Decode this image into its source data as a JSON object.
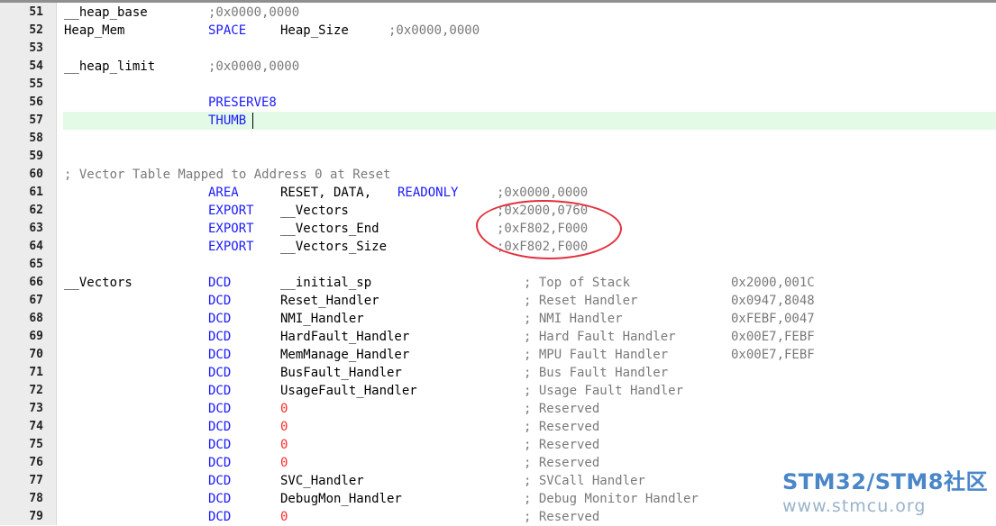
{
  "editor": {
    "lines": [
      {
        "n": "51",
        "tokens": [
          {
            "t": "__heap_base",
            "c": "",
            "col": 0
          },
          {
            "t": ";0x0000,0000",
            "c": "cm",
            "col": 16
          }
        ]
      },
      {
        "n": "52",
        "tokens": [
          {
            "t": "Heap_Mem",
            "c": "",
            "col": 0
          },
          {
            "t": "SPACE",
            "c": "kw",
            "col": 16
          },
          {
            "t": "Heap_Size",
            "c": "",
            "col": 24
          },
          {
            "t": ";0x0000,0000",
            "c": "cm",
            "col": 36
          }
        ]
      },
      {
        "n": "53",
        "tokens": []
      },
      {
        "n": "54",
        "tokens": [
          {
            "t": "__heap_limit",
            "c": "",
            "col": 0
          },
          {
            "t": ";0x0000,0000",
            "c": "cm",
            "col": 16
          }
        ]
      },
      {
        "n": "55",
        "tokens": []
      },
      {
        "n": "56",
        "tokens": [
          {
            "t": "PRESERVE8",
            "c": "kw",
            "col": 16
          }
        ]
      },
      {
        "n": "57",
        "tokens": [
          {
            "t": "THUMB",
            "c": "kw",
            "col": 16
          }
        ],
        "current": true
      },
      {
        "n": "58",
        "tokens": []
      },
      {
        "n": "59",
        "tokens": []
      },
      {
        "n": "60",
        "tokens": [
          {
            "t": "; Vector Table Mapped to Address 0 at Reset",
            "c": "cm",
            "col": 0
          }
        ]
      },
      {
        "n": "61",
        "tokens": [
          {
            "t": "AREA",
            "c": "kw",
            "col": 16
          },
          {
            "t": "RESET, DATA,",
            "c": "",
            "col": 24
          },
          {
            "t": "READONLY",
            "c": "kw",
            "col": 37
          },
          {
            "t": ";0x0000,0000",
            "c": "cm",
            "col": 48
          }
        ]
      },
      {
        "n": "62",
        "tokens": [
          {
            "t": "EXPORT",
            "c": "kw",
            "col": 16
          },
          {
            "t": "__Vectors",
            "c": "",
            "col": 24
          },
          {
            "t": ";0x2000,0760",
            "c": "cm",
            "col": 48
          }
        ]
      },
      {
        "n": "63",
        "tokens": [
          {
            "t": "EXPORT",
            "c": "kw",
            "col": 16
          },
          {
            "t": "__Vectors_End",
            "c": "",
            "col": 24
          },
          {
            "t": ";0xF802,F000",
            "c": "cm",
            "col": 48
          }
        ]
      },
      {
        "n": "64",
        "tokens": [
          {
            "t": "EXPORT",
            "c": "kw",
            "col": 16
          },
          {
            "t": "__Vectors_Size",
            "c": "",
            "col": 24
          },
          {
            "t": ";0xF802,F000",
            "c": "cm",
            "col": 48
          }
        ]
      },
      {
        "n": "65",
        "tokens": []
      },
      {
        "n": "66",
        "tokens": [
          {
            "t": "__Vectors",
            "c": "",
            "col": 0
          },
          {
            "t": "DCD",
            "c": "kw",
            "col": 16
          },
          {
            "t": "__initial_sp",
            "c": "",
            "col": 24
          },
          {
            "t": "; Top of Stack",
            "c": "cm",
            "col": 51
          },
          {
            "t": "0x2000,001C",
            "c": "cm",
            "col": 74
          }
        ]
      },
      {
        "n": "67",
        "tokens": [
          {
            "t": "DCD",
            "c": "kw",
            "col": 16
          },
          {
            "t": "Reset_Handler",
            "c": "",
            "col": 24
          },
          {
            "t": "; Reset Handler",
            "c": "cm",
            "col": 51
          },
          {
            "t": "0x0947,8048",
            "c": "cm",
            "col": 74
          }
        ]
      },
      {
        "n": "68",
        "tokens": [
          {
            "t": "DCD",
            "c": "kw",
            "col": 16
          },
          {
            "t": "NMI_Handler",
            "c": "",
            "col": 24
          },
          {
            "t": "; NMI Handler",
            "c": "cm",
            "col": 51
          },
          {
            "t": "0xFEBF,0047",
            "c": "cm",
            "col": 74
          }
        ]
      },
      {
        "n": "69",
        "tokens": [
          {
            "t": "DCD",
            "c": "kw",
            "col": 16
          },
          {
            "t": "HardFault_Handler",
            "c": "",
            "col": 24
          },
          {
            "t": "; Hard Fault Handler",
            "c": "cm",
            "col": 51
          },
          {
            "t": "0x00E7,FEBF",
            "c": "cm",
            "col": 74
          }
        ]
      },
      {
        "n": "70",
        "tokens": [
          {
            "t": "DCD",
            "c": "kw",
            "col": 16
          },
          {
            "t": "MemManage_Handler",
            "c": "",
            "col": 24
          },
          {
            "t": "; MPU Fault Handler",
            "c": "cm",
            "col": 51
          },
          {
            "t": "0x00E7,FEBF",
            "c": "cm",
            "col": 74
          }
        ]
      },
      {
        "n": "71",
        "tokens": [
          {
            "t": "DCD",
            "c": "kw",
            "col": 16
          },
          {
            "t": "BusFault_Handler",
            "c": "",
            "col": 24
          },
          {
            "t": "; Bus Fault Handler",
            "c": "cm",
            "col": 51
          }
        ]
      },
      {
        "n": "72",
        "tokens": [
          {
            "t": "DCD",
            "c": "kw",
            "col": 16
          },
          {
            "t": "UsageFault_Handler",
            "c": "",
            "col": 24
          },
          {
            "t": "; Usage Fault Handler",
            "c": "cm",
            "col": 51
          }
        ]
      },
      {
        "n": "73",
        "tokens": [
          {
            "t": "DCD",
            "c": "kw",
            "col": 16
          },
          {
            "t": "0",
            "c": "nm",
            "col": 24
          },
          {
            "t": "; Reserved",
            "c": "cm",
            "col": 51
          }
        ]
      },
      {
        "n": "74",
        "tokens": [
          {
            "t": "DCD",
            "c": "kw",
            "col": 16
          },
          {
            "t": "0",
            "c": "nm",
            "col": 24
          },
          {
            "t": "; Reserved",
            "c": "cm",
            "col": 51
          }
        ]
      },
      {
        "n": "75",
        "tokens": [
          {
            "t": "DCD",
            "c": "kw",
            "col": 16
          },
          {
            "t": "0",
            "c": "nm",
            "col": 24
          },
          {
            "t": "; Reserved",
            "c": "cm",
            "col": 51
          }
        ]
      },
      {
        "n": "76",
        "tokens": [
          {
            "t": "DCD",
            "c": "kw",
            "col": 16
          },
          {
            "t": "0",
            "c": "nm",
            "col": 24
          },
          {
            "t": "; Reserved",
            "c": "cm",
            "col": 51
          }
        ]
      },
      {
        "n": "77",
        "tokens": [
          {
            "t": "DCD",
            "c": "kw",
            "col": 16
          },
          {
            "t": "SVC_Handler",
            "c": "",
            "col": 24
          },
          {
            "t": "; SVCall Handler",
            "c": "cm",
            "col": 51
          }
        ]
      },
      {
        "n": "78",
        "tokens": [
          {
            "t": "DCD",
            "c": "kw",
            "col": 16
          },
          {
            "t": "DebugMon_Handler",
            "c": "",
            "col": 24
          },
          {
            "t": "; Debug Monitor Handler",
            "c": "cm",
            "col": 51
          }
        ]
      },
      {
        "n": "79",
        "tokens": [
          {
            "t": "DCD",
            "c": "kw",
            "col": 16
          },
          {
            "t": "0",
            "c": "nm",
            "col": 24
          },
          {
            "t": "; Reserved",
            "c": "cm",
            "col": 51
          }
        ]
      }
    ]
  },
  "watermark": {
    "title": "STM32/STM8社区",
    "url": "www.stmcu.org"
  },
  "colors": {
    "keyword": "#1a1aff",
    "comment": "#7a7a7a",
    "number": "#ff2a2a",
    "current_line": "#e3fae6",
    "annotation": "#e3303e"
  }
}
